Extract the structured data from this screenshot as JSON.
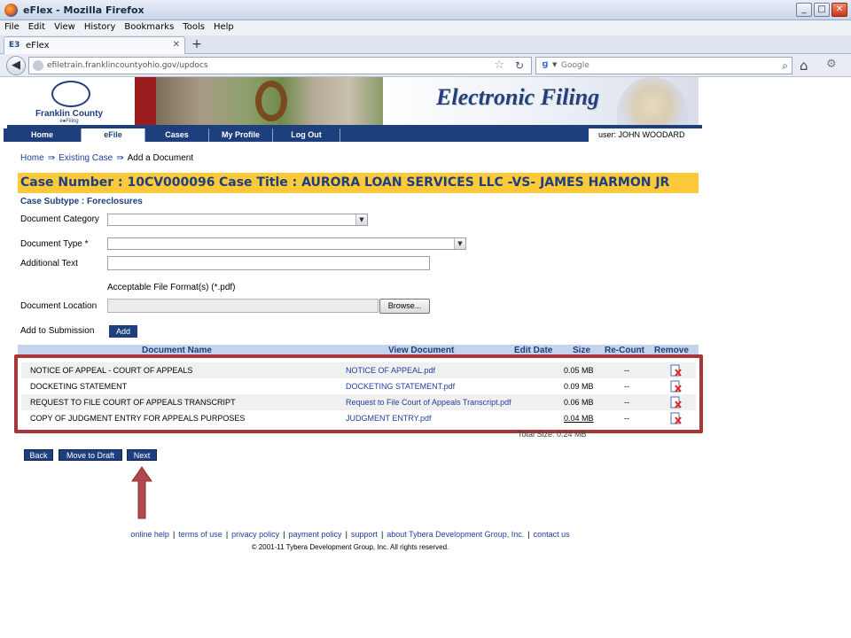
{
  "window": {
    "title": "eFlex - Mozilla Firefox",
    "buttons": {
      "minimize": "_",
      "maximize": "□",
      "close": "✕"
    }
  },
  "menu": [
    "File",
    "Edit",
    "View",
    "History",
    "Bookmarks",
    "Tools",
    "Help"
  ],
  "tab": {
    "icon": "E3",
    "label": "eFlex"
  },
  "address": {
    "url": "efiletrain.franklincountyohio.gov/updocs",
    "search_placeholder": "Google"
  },
  "banner": {
    "logo_line1": "Franklin County",
    "logo_line2": "e●Filing",
    "title": "Electronic Filing"
  },
  "nav": {
    "items": [
      "Home",
      "eFile",
      "Cases",
      "My Profile",
      "Log Out"
    ],
    "active": "eFile",
    "user": "user: JOHN WOODARD"
  },
  "breadcrumb": [
    "Home",
    "Existing Case",
    "Add a Document"
  ],
  "case": {
    "number": "Case Number : 10CV000096",
    "title": "Case Title : AURORA LOAN SERVICES LLC -VS- JAMES HARMON JR",
    "subtype": "Case Subtype : Foreclosures"
  },
  "form": {
    "category_label": "Document Category",
    "type_label": "Document Type *",
    "additional_label": "Additional Text",
    "acceptable": "Acceptable File Format(s) (*.pdf)",
    "location_label": "Document Location",
    "browse": "Browse...",
    "add_label": "Add to Submission",
    "add_button": "Add"
  },
  "table": {
    "headers": [
      "Document Name",
      "View Document",
      "Edit Date",
      "Size",
      "Re-Count",
      "Remove"
    ],
    "rows": [
      {
        "name": "NOTICE OF APPEAL - COURT OF APPEALS",
        "file": "NOTICE OF APPEAL.pdf",
        "size": "0.05 MB",
        "recount": "--"
      },
      {
        "name": "DOCKETING STATEMENT",
        "file": "DOCKETING STATEMENT.pdf",
        "size": "0.09 MB",
        "recount": "--"
      },
      {
        "name": "REQUEST TO FILE COURT OF APPEALS TRANSCRIPT",
        "file": "Request to File Court of Appeals Transcript.pdf",
        "size": "0.06 MB",
        "recount": "--"
      },
      {
        "name": "COPY OF JUDGMENT ENTRY FOR APPEALS PURPOSES",
        "file": "JUDGMENT ENTRY.pdf",
        "size": "0.04 MB",
        "recount": "--"
      }
    ],
    "total": "Total Size:   0.24 MB"
  },
  "buttons": {
    "back": "Back",
    "draft": "Move to Draft",
    "next": "Next"
  },
  "footer": {
    "links": [
      "online help",
      "terms of use",
      "privacy policy",
      "payment policy",
      "support",
      "about Tybera Development Group, Inc.",
      "contact us"
    ],
    "copyright": "© 2001-11 Tybera Development Group, Inc. All rights reserved."
  },
  "colors": {
    "nav_blue": "#1e3f7d",
    "case_bar": "#fcc93a",
    "highlight_border": "#a8373a",
    "link": "#1e3f9c"
  }
}
